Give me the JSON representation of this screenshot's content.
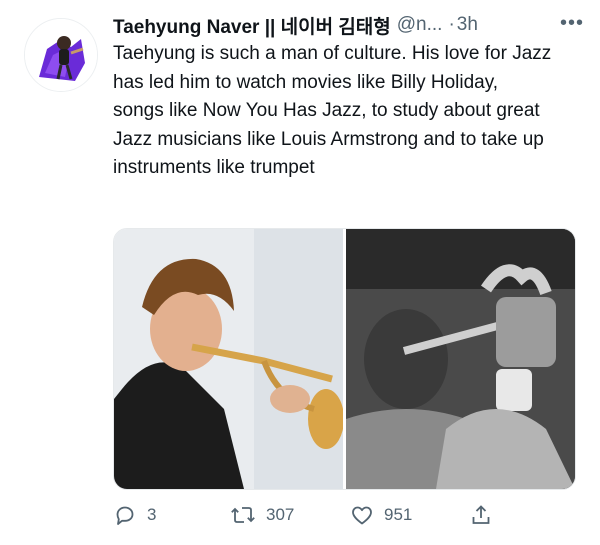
{
  "tweet": {
    "author_name": "Taehyung Naver || 네이버 김태형",
    "author_handle": "@n...",
    "separator": "·",
    "timestamp": "3h",
    "more_label": "•••",
    "text": "Taehyung is such a man of culture. His love for Jazz has led him to watch movies like Billy Holiday, songs like Now You Has Jazz, to study about great Jazz musicians like Louis Armstrong and to take up instruments like trumpet"
  },
  "media": {
    "images": [
      {
        "name": "young man playing a trumpet"
      },
      {
        "name": "black and white photo of a trumpet player"
      }
    ]
  },
  "actions": {
    "reply_count": "3",
    "retweet_count": "307",
    "like_count": "951"
  },
  "icons": {
    "reply": "reply-icon",
    "retweet": "retweet-icon",
    "like": "heart-icon",
    "share": "share-icon",
    "more": "more-icon"
  },
  "colors": {
    "text": "#0f1419",
    "secondary": "#536471",
    "avatar_purple": "#6a2bd8"
  }
}
